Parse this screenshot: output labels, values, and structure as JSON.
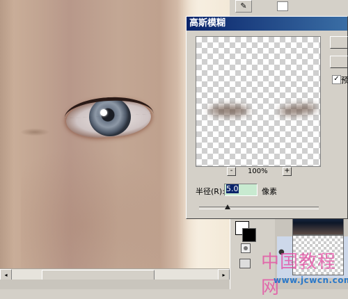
{
  "dialog": {
    "title": "高斯模糊",
    "zoom_minus": "-",
    "zoom_plus": "+",
    "zoom_value": "100%",
    "radius_label": "半径(R):",
    "radius_value": "5.0",
    "radius_unit": "像素",
    "radius_slider_fraction": 0.24,
    "preview_label": "预",
    "preview_checked": "✓"
  },
  "toolbar": {
    "brush_icon": "✎"
  },
  "canvas": {
    "scroll_left": "◂",
    "scroll_right": "▸"
  },
  "layers": {
    "visibility_icon": "●"
  },
  "watermark": {
    "text": "中国教程网",
    "url": "www.jcwcn.com"
  },
  "colors": {
    "titlebar": "#0a246a",
    "radius_field": "#c8ead0",
    "selection": "#0a246a"
  }
}
